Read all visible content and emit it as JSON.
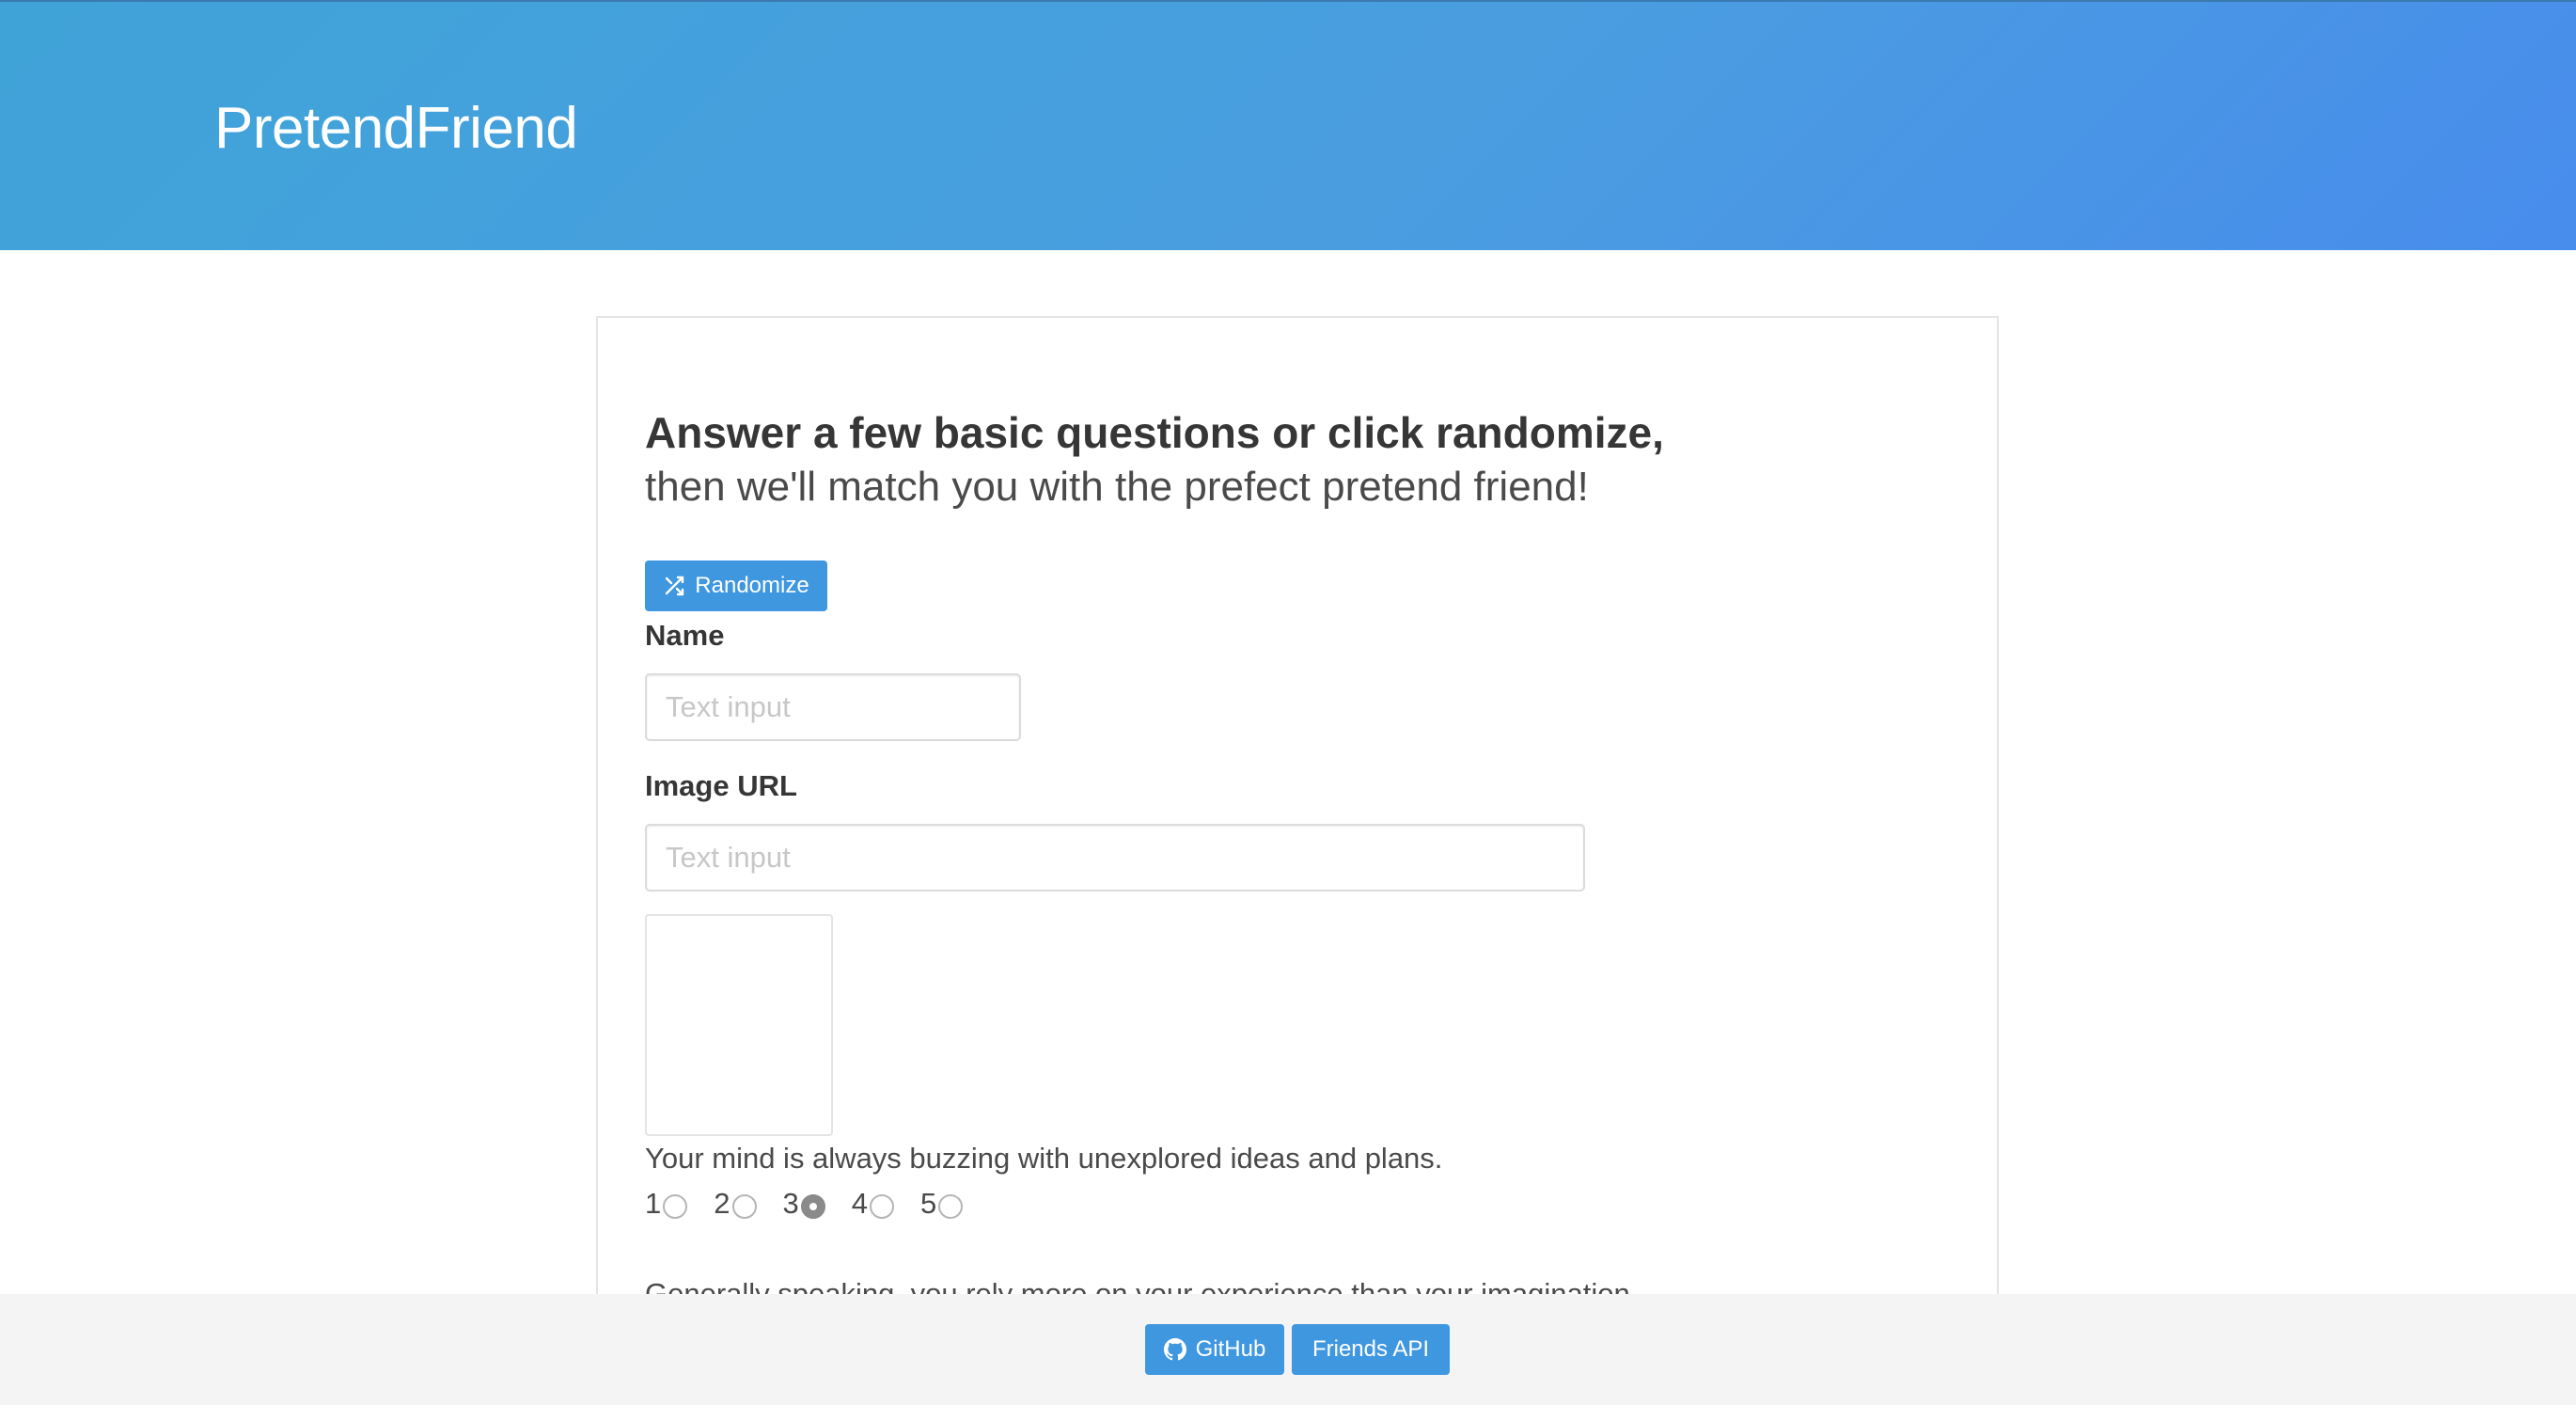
{
  "header": {
    "brand": "PretendFriend"
  },
  "form": {
    "heading_strong": "Answer a few basic questions or click randomize,",
    "heading_sub": "then we'll match you with the prefect pretend friend!",
    "randomize_label": "Randomize",
    "name_label": "Name",
    "name_placeholder": "Text input",
    "image_url_label": "Image URL",
    "image_url_placeholder": "Text input",
    "questions": [
      {
        "text": "Your mind is always buzzing with unexplored ideas and plans.",
        "options": [
          "1",
          "2",
          "3",
          "4",
          "5"
        ],
        "selected": "3"
      },
      {
        "text": "Generally speaking, you rely more on your experience than your imagination."
      }
    ]
  },
  "footer": {
    "github_label": "GitHub",
    "api_label": "Friends API"
  },
  "colors": {
    "primary": "#3f97e0",
    "hero_start": "#3fa3d8",
    "hero_end": "#488cec",
    "footer_bg": "#f4f4f4"
  },
  "icons": {
    "randomize": "shuffle-icon",
    "github": "github-icon"
  }
}
